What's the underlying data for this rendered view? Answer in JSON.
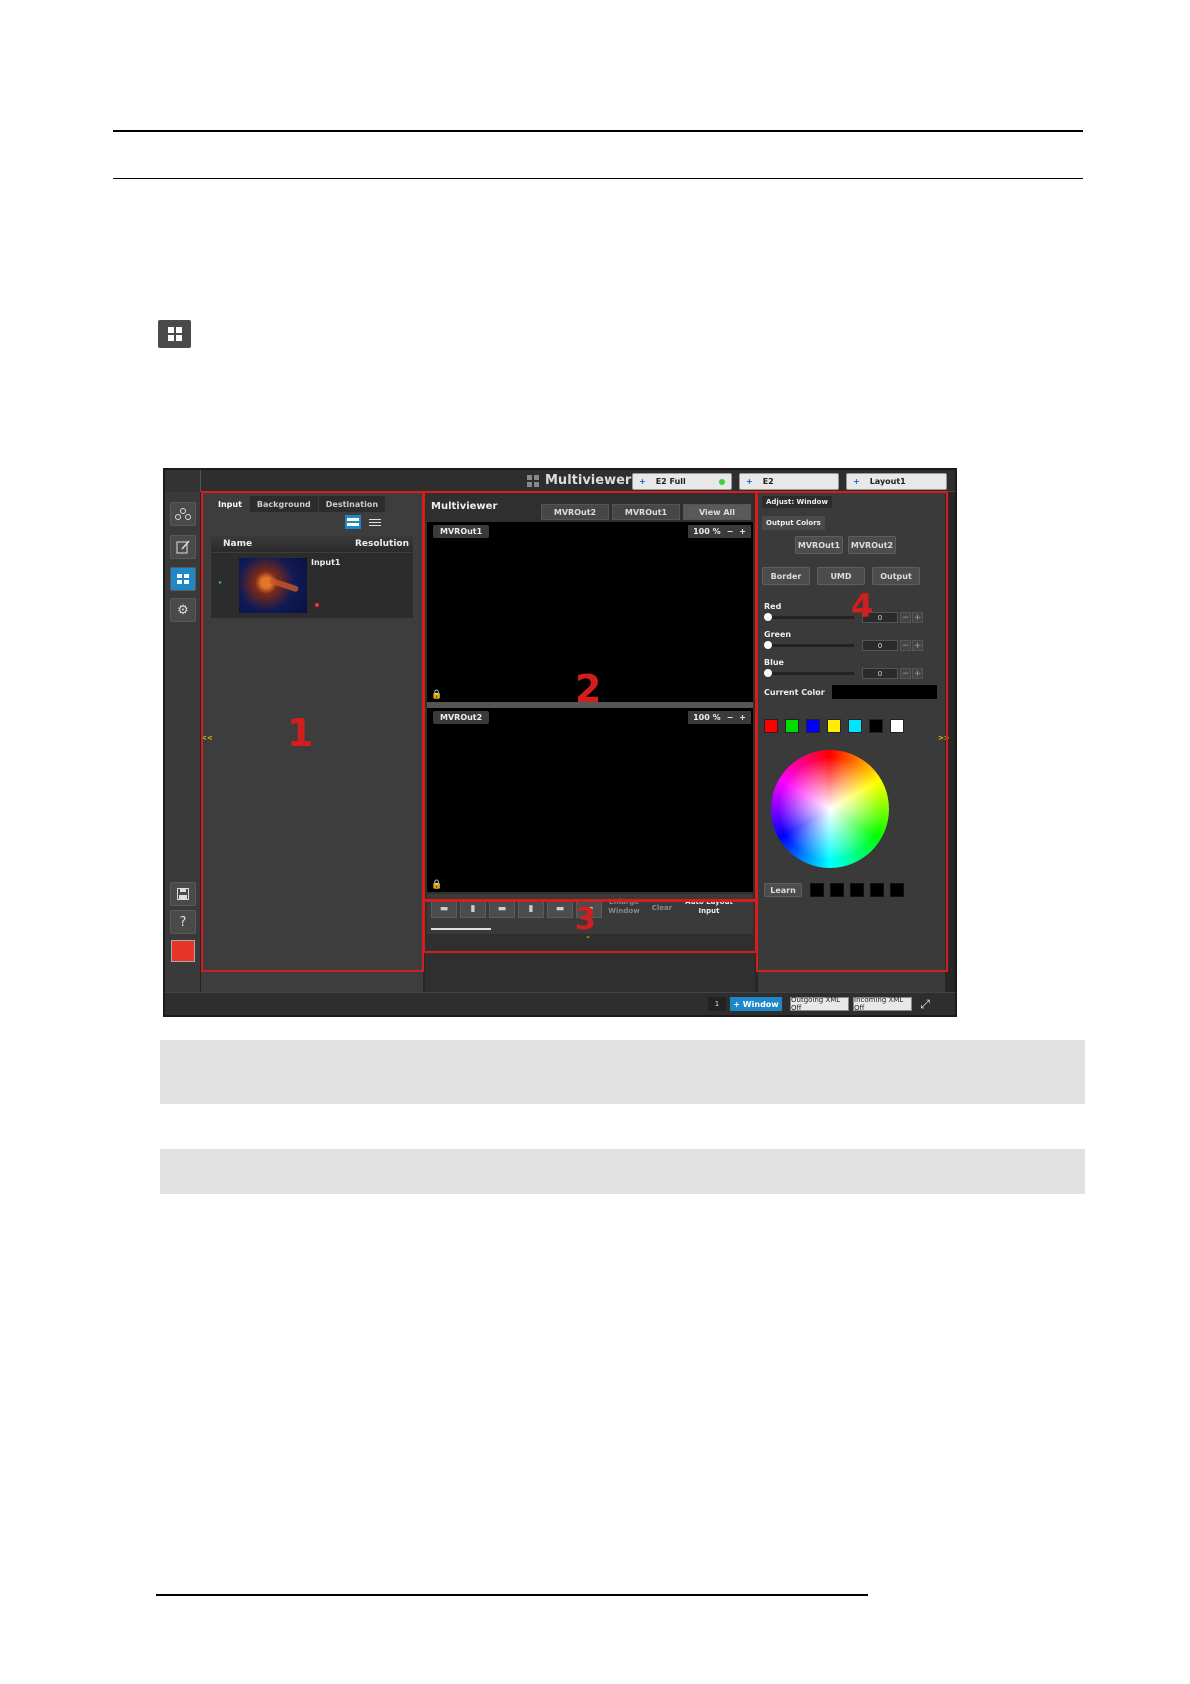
{
  "page": {
    "icon": "layout-grid-icon"
  },
  "screenshot": {
    "title": "Multiviewer",
    "title_icon": "multiviewer-grid-icon",
    "dest_tabs": [
      {
        "label": "E2 Full",
        "plus": "+"
      },
      {
        "label": "E2",
        "plus": "+"
      },
      {
        "label": "Layout1",
        "plus": "+"
      }
    ],
    "left_icons": [
      "network-icon",
      "edit-icon",
      "multiviewer-icon",
      "gear-icon",
      "save-icon",
      "help-icon",
      "logo-icon"
    ],
    "help_glyph": "?",
    "panel1": {
      "tabs": [
        "Input",
        "Background",
        "Destination"
      ],
      "columns": {
        "name": "Name",
        "resolution": "Resolution"
      },
      "items": [
        {
          "name": "Input1"
        }
      ],
      "collapse_left": "<<"
    },
    "panel2": {
      "title": "Multiviewer",
      "tabs": [
        "MVROut2",
        "MVROut1",
        "View All"
      ],
      "screens": [
        {
          "label": "MVROut1",
          "zoom": "100 %"
        },
        {
          "label": "MVROut2",
          "zoom": "100 %"
        }
      ],
      "zoom_minus": "−",
      "zoom_plus": "+",
      "toolbar": {
        "enlarge": "Enlarge\nWindow",
        "clear": "Clear",
        "auto_layout": "Auto Layout\nInput",
        "expand": "⌄"
      }
    },
    "panel4": {
      "tab": "Adjust: Window",
      "subtab": "Output Colors",
      "outputs": [
        "MVROut1",
        "MVROut2"
      ],
      "sections": [
        "Border",
        "UMD",
        "Output"
      ],
      "sliders": [
        {
          "label": "Red",
          "value": "0"
        },
        {
          "label": "Green",
          "value": "0"
        },
        {
          "label": "Blue",
          "value": "0"
        }
      ],
      "current_color_label": "Current Color",
      "current_color": "#000000",
      "swatches": [
        "#ff0000",
        "#00dd00",
        "#0000ff",
        "#ffee00",
        "#00e5ff",
        "#000000",
        "#ffffff"
      ],
      "learn": "Learn",
      "collapse_right": ">>"
    },
    "bottom": {
      "page": "1",
      "add_window": "+ Window",
      "outgoing": "Outgoing XML Off",
      "incoming": "Incoming XML Off",
      "fullscreen_icon": "fullscreen-icon"
    },
    "callouts": [
      "1",
      "2",
      "3",
      "4"
    ],
    "colors": {
      "callout": "#d21e1e",
      "accent": "#1e88c8"
    }
  }
}
